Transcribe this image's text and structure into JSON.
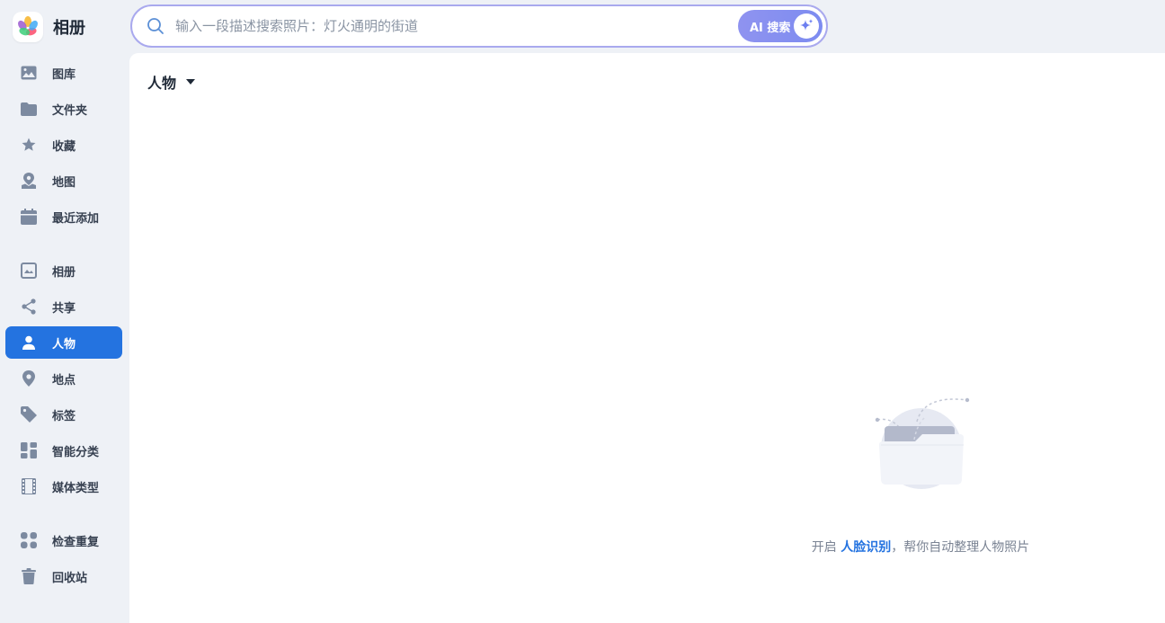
{
  "app": {
    "title": "相册"
  },
  "search": {
    "placeholder": "输入一段描述搜索照片：灯火通明的街道",
    "ai_button_label": "AI 搜索"
  },
  "sidebar": {
    "items": [
      {
        "label": "图库",
        "icon": "image-icon"
      },
      {
        "label": "文件夹",
        "icon": "folder-icon"
      },
      {
        "label": "收藏",
        "icon": "star-icon"
      },
      {
        "label": "地图",
        "icon": "map-pin-icon"
      },
      {
        "label": "最近添加",
        "icon": "calendar-icon"
      },
      {
        "label": "相册",
        "icon": "album-icon"
      },
      {
        "label": "共享",
        "icon": "share-icon"
      },
      {
        "label": "人物",
        "icon": "person-icon",
        "active": true
      },
      {
        "label": "地点",
        "icon": "location-icon"
      },
      {
        "label": "标签",
        "icon": "tag-icon"
      },
      {
        "label": "智能分类",
        "icon": "dashboard-icon"
      },
      {
        "label": "媒体类型",
        "icon": "film-icon"
      },
      {
        "label": "检查重复",
        "icon": "grid-dots-icon"
      },
      {
        "label": "回收站",
        "icon": "trash-icon"
      }
    ]
  },
  "main": {
    "filter_label": "人物",
    "empty": {
      "prefix": "开启 ",
      "link": "人脸识别",
      "suffix": "，帮你自动整理人物照片"
    }
  },
  "colors": {
    "accent": "#2473e0",
    "sidebar_bg": "#eef1f6",
    "icon": "#7c8aa0"
  }
}
